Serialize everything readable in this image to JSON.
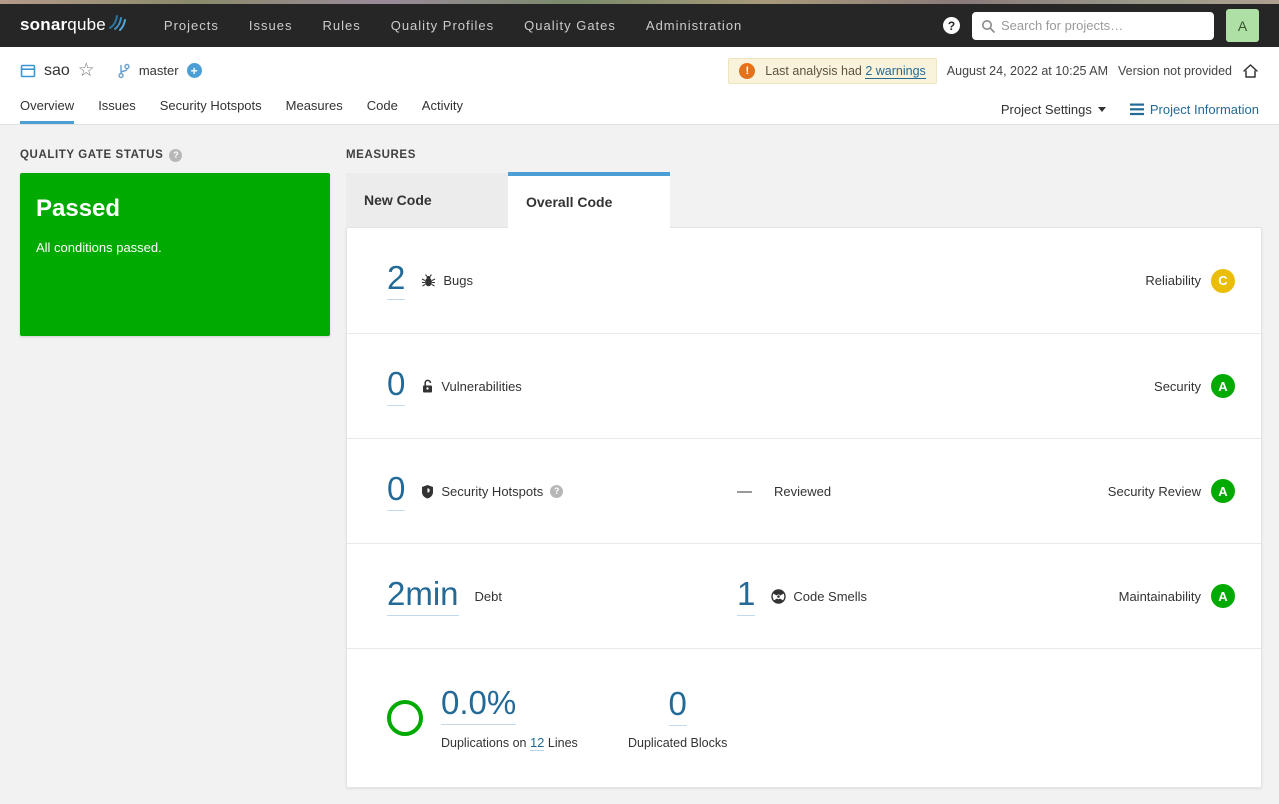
{
  "topbar": {
    "logo_bold": "sonar",
    "logo_light": "qube",
    "nav": [
      {
        "label": "Projects"
      },
      {
        "label": "Issues"
      },
      {
        "label": "Rules"
      },
      {
        "label": "Quality Profiles"
      },
      {
        "label": "Quality Gates"
      },
      {
        "label": "Administration"
      }
    ],
    "help": "?",
    "search_placeholder": "Search for projects…",
    "avatar_initial": "A"
  },
  "header": {
    "project_name": "sao",
    "branch_name": "master",
    "warning": {
      "icon": "!",
      "prefix": "Last analysis had ",
      "link": "2 warnings"
    },
    "analysis_date": "August 24, 2022 at 10:25 AM",
    "version": "Version not provided",
    "tabs": [
      {
        "label": "Overview"
      },
      {
        "label": "Issues"
      },
      {
        "label": "Security Hotspots"
      },
      {
        "label": "Measures"
      },
      {
        "label": "Code"
      },
      {
        "label": "Activity"
      }
    ],
    "project_settings_label": "Project Settings",
    "project_information_label": "Project Information"
  },
  "quality_gate": {
    "heading": "QUALITY GATE STATUS",
    "status": "Passed",
    "message": "All conditions passed."
  },
  "measures": {
    "heading": "MEASURES",
    "tabs": [
      {
        "label": "New Code"
      },
      {
        "label": "Overall Code"
      }
    ],
    "rows": [
      {
        "value": "2",
        "label": "Bugs",
        "domain": "Reliability",
        "rating": "C",
        "rating_color": "#eabe06"
      },
      {
        "value": "0",
        "label": "Vulnerabilities",
        "domain": "Security",
        "rating": "A",
        "rating_color": "#00aa00"
      },
      {
        "value": "0",
        "label": "Security Hotspots",
        "mid_dash": "—",
        "mid_label": "Reviewed",
        "domain": "Security Review",
        "rating": "A",
        "rating_color": "#00aa00"
      },
      {
        "value": "2min",
        "label": "Debt",
        "mid_value": "1",
        "mid_label": "Code Smells",
        "domain": "Maintainability",
        "rating": "A",
        "rating_color": "#00aa00"
      }
    ],
    "duplications": {
      "percent": "0.0%",
      "label_prefix": "Duplications on ",
      "lines_value": "12",
      "label_suffix": " Lines",
      "blocks_value": "0",
      "blocks_label": "Duplicated Blocks"
    }
  },
  "colors": {
    "green": "#00aa00",
    "yellow": "#eabe06",
    "blue_link": "#236a97",
    "blue_accent": "#4b9fd5",
    "orange": "#e2731c",
    "navbar_bg": "#262626"
  }
}
